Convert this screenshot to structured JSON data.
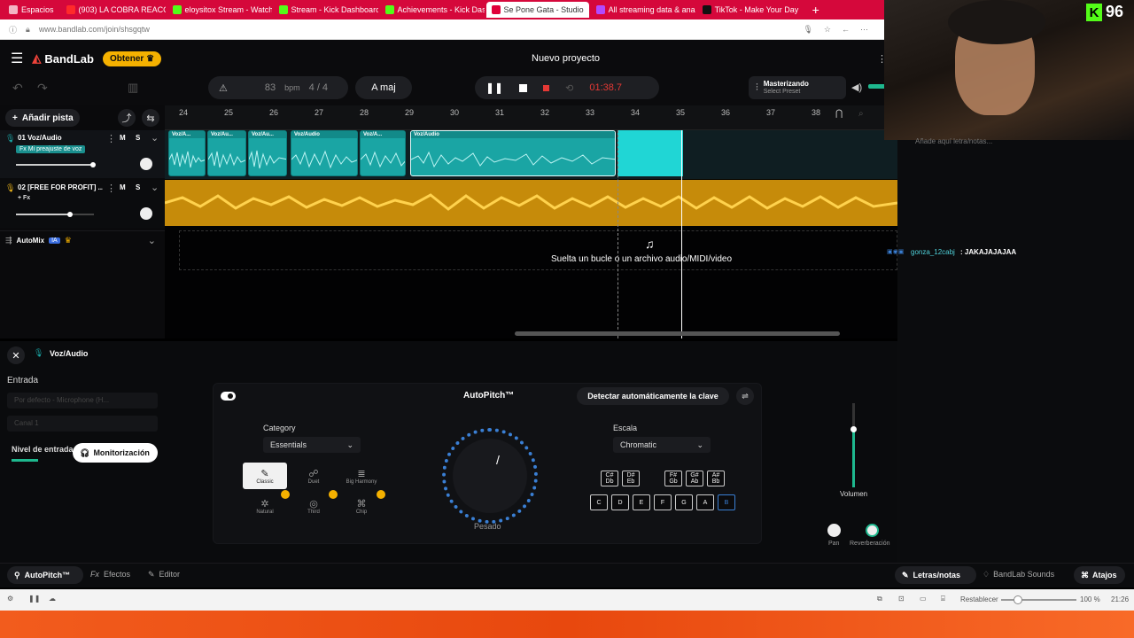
{
  "browser": {
    "tabs": [
      {
        "label": "Espacios",
        "color": "#ffffff"
      },
      {
        "label": "(903) LA COBRA REACCION",
        "color": "#ff2a2a"
      },
      {
        "label": "eloysitox Stream - Watch L",
        "color": "#53fc18"
      },
      {
        "label": "Stream - Kick Dashboard",
        "color": "#53fc18"
      },
      {
        "label": "Achievements - Kick Dashb",
        "color": "#53fc18"
      },
      {
        "label": "Se Pone Gata - Studio",
        "color": "#e0003a"
      },
      {
        "label": "All streaming data & analyt",
        "color": "#b14aff"
      },
      {
        "label": "TikTok - Make Your Day",
        "color": "#111111"
      }
    ],
    "new_tab": "+",
    "url": "www.bandlab.com/join/shsgqtw"
  },
  "app": {
    "brand": "BandLab",
    "get_button": "Obtener",
    "project_title": "Nuevo proyecto",
    "bpm_value": "83",
    "bpm_label": "bpm",
    "time_sig": "4 / 4",
    "key": "A maj",
    "time": "01:38.7",
    "mastering_title": "Masterizando",
    "mastering_sub": "Select Preset",
    "add_track": "Añadir pista"
  },
  "ruler": [
    "24",
    "25",
    "26",
    "27",
    "28",
    "29",
    "30",
    "31",
    "32",
    "33",
    "34",
    "35",
    "36",
    "37",
    "38"
  ],
  "tracks": [
    {
      "name": "01  Voz/Audio",
      "preset": "Mi preajuste de voz",
      "m": "M",
      "s": "S"
    },
    {
      "name": "02  [FREE FOR PROFIT] ...",
      "preset": "+ Fx",
      "m": "M",
      "s": "S"
    }
  ],
  "automix": {
    "label": "AutoMix",
    "badge": "IA"
  },
  "clips": [
    {
      "label": "Voz/A..."
    },
    {
      "label": "Voz/Au..."
    },
    {
      "label": "Voz/Au..."
    },
    {
      "label": "Voz/Audio"
    },
    {
      "label": "Voz/A..."
    },
    {
      "label": "Voz/Audio"
    }
  ],
  "drop_hint": "Suelta un bucle o un archivo audio/MIDI/video",
  "lyrics_placeholder": "Añade aquí letra/notas...",
  "chat": {
    "user": "gonza_12cabj",
    "message": "JAKAJAJAJAA"
  },
  "bottom": {
    "panel_title": "Voz/Audio",
    "input_label": "Entrada",
    "input_device": "Por defecto - Microphone (H...",
    "channel": "Canal 1",
    "level_label": "Nivel de entrada",
    "monitor_button": "Monitorización",
    "autopitch_title": "AutoPitch™",
    "detect_key": "Detectar automáticamente la clave",
    "category_label": "Category",
    "category_value": "Essentials",
    "presets": [
      "Classic",
      "Duet",
      "Big Harmony",
      "Natural",
      "Third",
      "Chip"
    ],
    "knob_label": "Pesado",
    "scale_label": "Escala",
    "scale_value": "Chromatic",
    "sharp_keys": [
      "C#\nDb",
      "D#\nEb",
      "F#\nGb",
      "G#\nAb",
      "A#\nBb"
    ],
    "natural_keys": [
      "C",
      "D",
      "E",
      "F",
      "G",
      "A",
      "B"
    ],
    "volume_label": "Volumen",
    "pan_label": "Pan",
    "reverb_label": "Reverberación"
  },
  "bottombar": {
    "tabs": [
      "AutoPitch™",
      "Efectos",
      "Editor"
    ],
    "right": [
      "Letras/notas",
      "BandLab Sounds",
      "Atajos"
    ]
  },
  "status": {
    "reset": "Restablecer",
    "zoom": "100 %",
    "clock": "21:26"
  },
  "webcam_badge": "96",
  "colors": {
    "teal": "#1aa5a4",
    "gold": "#e8b21a",
    "accent": "#e53935",
    "brand_red": "#f0433a"
  }
}
